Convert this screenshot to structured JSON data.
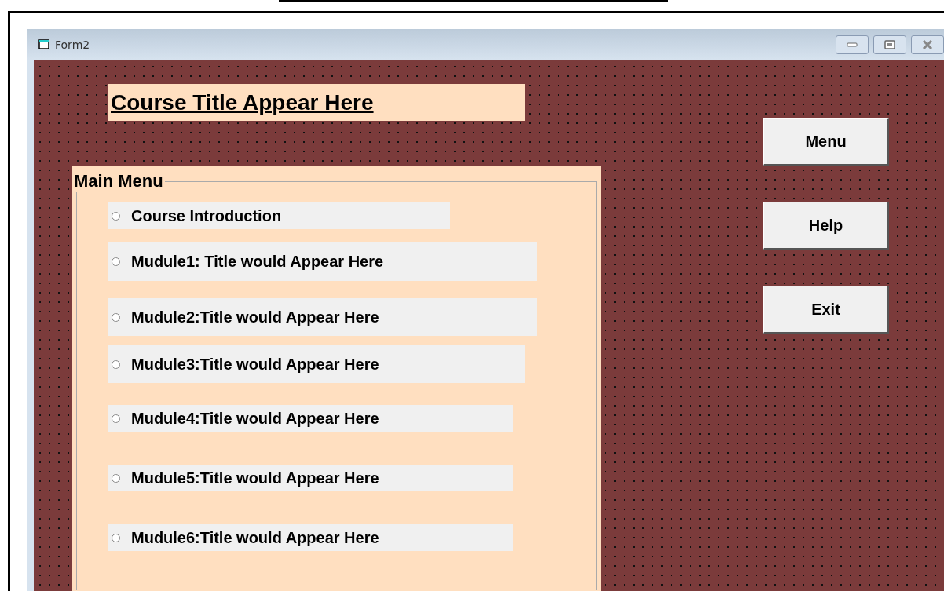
{
  "window": {
    "title": "Form2"
  },
  "course_title": "Course Title Appear Here",
  "main_menu": {
    "title": "Main Menu",
    "options": [
      {
        "label": "Course Introduction",
        "selected": false
      },
      {
        "label": "Mudule1: Title would Appear Here",
        "selected": false
      },
      {
        "label": "Mudule2:Title would Appear Here",
        "selected": false
      },
      {
        "label": "Mudule3:Title would Appear Here",
        "selected": false
      },
      {
        "label": "Mudule4:Title would Appear Here",
        "selected": false
      },
      {
        "label": "Mudule5:Title would Appear Here",
        "selected": false
      },
      {
        "label": "Mudule6:Title would Appear Here",
        "selected": false
      }
    ]
  },
  "buttons": [
    "Menu",
    "Help",
    "Exit"
  ]
}
